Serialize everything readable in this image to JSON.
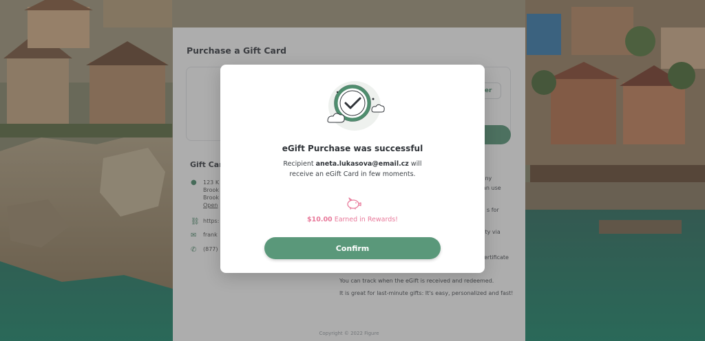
{
  "page": {
    "title": "Purchase a Gift Card",
    "amount_other_label": "Other",
    "gift_info_title": "Gift Card",
    "info": {
      "address_lines": [
        "123 K",
        "Brook",
        "Brook",
        "Open"
      ],
      "website": "https:",
      "email": "frank",
      "phone": "(877)"
    },
    "description_lines": [
      "to any",
      "an use",
      "s for",
      "rity via",
      "ertificate",
      "You can track when the eGift is received and redeemed.",
      "It is great for last-minute gifts: It's easy, personalized and fast!"
    ],
    "copyright": "Copyright © 2022 Figure"
  },
  "modal": {
    "title": "eGift Purchase was successful",
    "message_prefix": "Recipient ",
    "recipient_email": "aneta.lukasova@email.cz",
    "message_suffix": " will receive an eGift Card in few moments.",
    "rewards_amount": "$10.00",
    "rewards_text": " Earned in Rewards!",
    "confirm_label": "Confirm"
  },
  "colors": {
    "accent": "#5a987a",
    "rewards_pink": "#e8799a",
    "success_ring": "#4f8d6e"
  },
  "icons": {
    "success": "success-check-cloud-icon",
    "rewards": "piggy-bank-icon",
    "address": "map-pin-icon",
    "website": "link-icon",
    "email": "mail-icon",
    "phone": "phone-icon"
  }
}
